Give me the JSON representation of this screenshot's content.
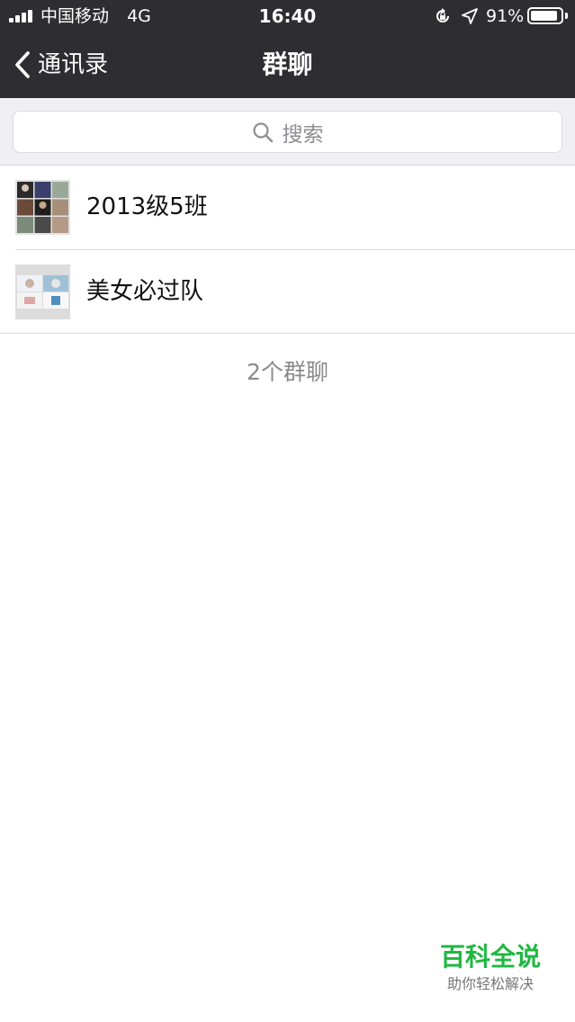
{
  "status_bar": {
    "carrier": "中国移动",
    "network": "4G",
    "time": "16:40",
    "battery_percent": "91%",
    "battery_level": 0.91
  },
  "nav": {
    "back_label": "通讯录",
    "title": "群聊"
  },
  "search": {
    "placeholder": "搜索"
  },
  "groups": [
    {
      "name": "2013级5班",
      "avatar": "group-photo-grid-9"
    },
    {
      "name": "美女必过队",
      "avatar": "group-photo-grid-4"
    }
  ],
  "footer": {
    "count_label": "2个群聊"
  },
  "watermark": {
    "title": "百科全说",
    "subtitle": "助你轻松解决",
    "color": "#1fb841"
  },
  "colors": {
    "header_bg": "#2e2e32",
    "page_bg": "#ffffff",
    "search_strip_bg": "#efeff4"
  }
}
